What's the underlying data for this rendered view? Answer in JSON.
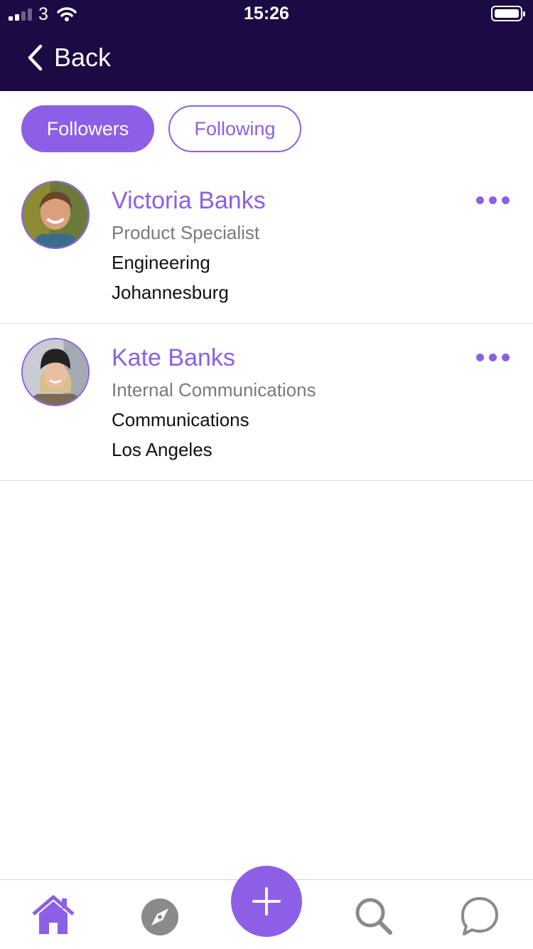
{
  "status_bar": {
    "carrier": "3",
    "time": "15:26"
  },
  "nav": {
    "back_label": "Back"
  },
  "tabs": [
    {
      "label": "Followers",
      "active": true
    },
    {
      "label": "Following",
      "active": false
    }
  ],
  "people": [
    {
      "name": "Victoria Banks",
      "title": "Product Specialist",
      "department": "Engineering",
      "location": "Johannesburg",
      "avatar": "avatar-photo"
    },
    {
      "name": "Kate Banks",
      "title": "Internal Communications",
      "department": "Communications",
      "location": "Los Angeles",
      "avatar": "avatar-photo"
    }
  ],
  "tab_bar": {
    "items": [
      "home-icon",
      "compass-icon",
      "plus-icon",
      "search-icon",
      "chat-icon"
    ]
  },
  "colors": {
    "accent": "#8c5fe6",
    "header": "#1c0a45",
    "icon_inactive": "#8a8a8a"
  }
}
